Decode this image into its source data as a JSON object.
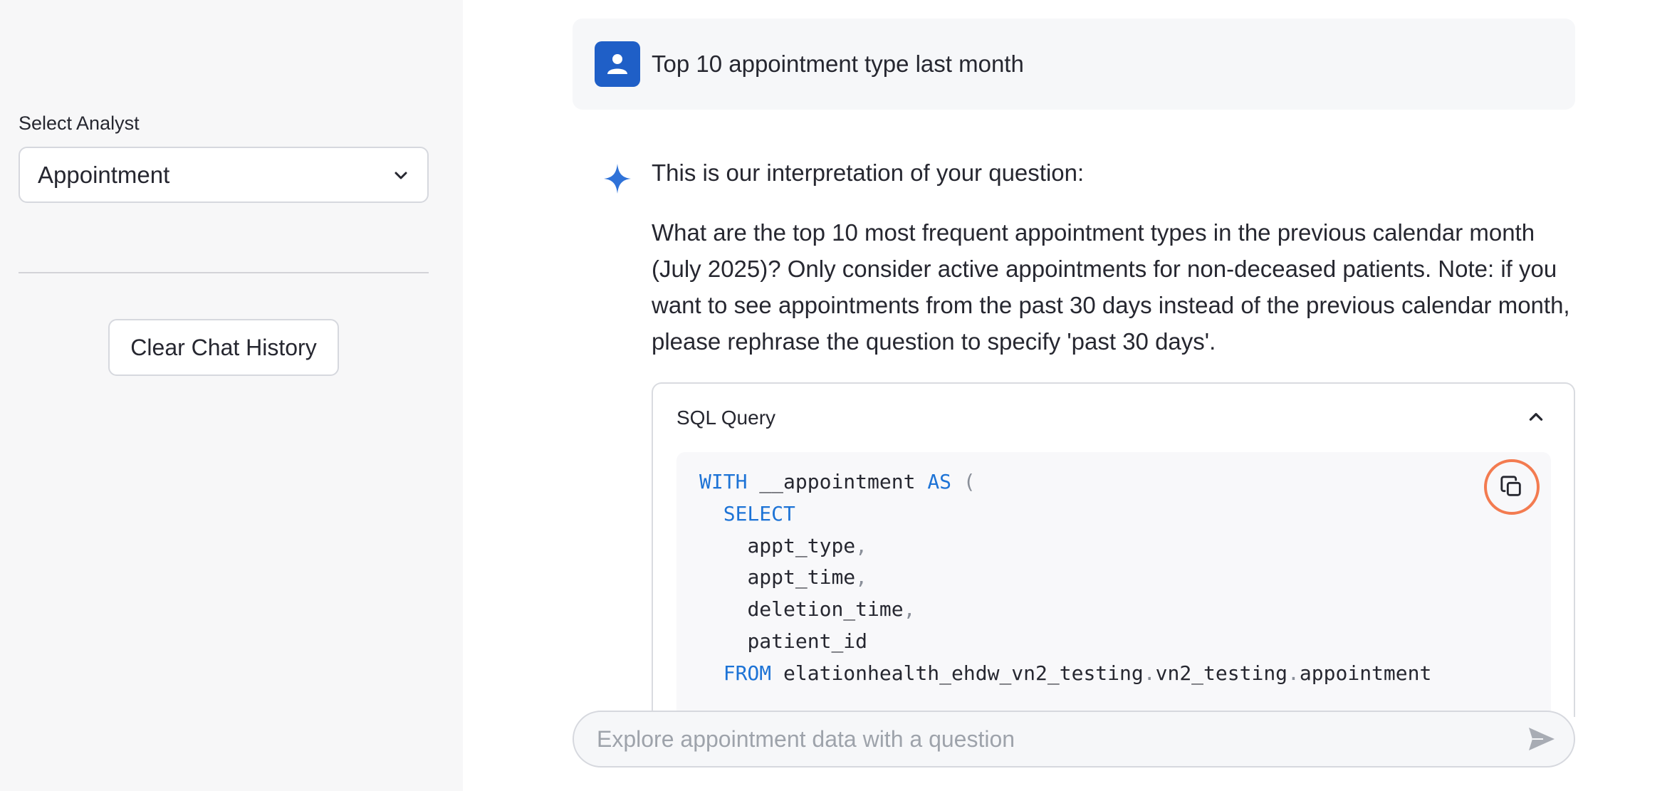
{
  "sidebar": {
    "analyst_label": "Select Analyst",
    "analyst_value": "Appointment",
    "clear_button": "Clear Chat History"
  },
  "user_message": {
    "text": "Top 10 appointment type last month"
  },
  "assistant_message": {
    "intro": "This is our interpretation of your question:",
    "interpretation": "What are the top 10 most frequent appointment types in the previous calendar month (July 2025)? Only consider active appointments for non-deceased patients. Note: if you want to see appointments from the past 30 days instead of the previous calendar month, please rephrase the question to specify 'past 30 days'.",
    "sql": {
      "title": "SQL Query",
      "lines": [
        {
          "indent": "",
          "tokens": [
            {
              "t": "kw",
              "v": "WITH"
            },
            {
              "t": "tx",
              "v": " __appointment "
            },
            {
              "t": "kw",
              "v": "AS"
            },
            {
              "t": "tx",
              "v": " "
            },
            {
              "t": "pn",
              "v": "("
            }
          ]
        },
        {
          "indent": "  ",
          "tokens": [
            {
              "t": "kw",
              "v": "SELECT"
            }
          ]
        },
        {
          "indent": "    ",
          "tokens": [
            {
              "t": "tx",
              "v": "appt_type"
            },
            {
              "t": "pn",
              "v": ","
            }
          ]
        },
        {
          "indent": "    ",
          "tokens": [
            {
              "t": "tx",
              "v": "appt_time"
            },
            {
              "t": "pn",
              "v": ","
            }
          ]
        },
        {
          "indent": "    ",
          "tokens": [
            {
              "t": "tx",
              "v": "deletion_time"
            },
            {
              "t": "pn",
              "v": ","
            }
          ]
        },
        {
          "indent": "    ",
          "tokens": [
            {
              "t": "tx",
              "v": "patient_id"
            }
          ]
        },
        {
          "indent": "  ",
          "tokens": [
            {
              "t": "kw",
              "v": "FROM"
            },
            {
              "t": "tx",
              "v": " elationhealth_ehdw_vn2_testing"
            },
            {
              "t": "pn",
              "v": "."
            },
            {
              "t": "tx",
              "v": "vn2_testing"
            },
            {
              "t": "pn",
              "v": "."
            },
            {
              "t": "tx",
              "v": "appointment"
            }
          ]
        }
      ]
    }
  },
  "chat_input": {
    "placeholder": "Explore appointment data with a question"
  },
  "icons": {
    "avatar": "user-icon",
    "assistant": "sparkle-icon",
    "select": "chevron-down-icon",
    "expander": "chevron-up-icon",
    "copy": "copy-icon",
    "send": "send-icon"
  },
  "colors": {
    "avatar_bg": "#1f5fc7",
    "sparkle": "#2f72d8",
    "keyword": "#1d73d6",
    "copy_highlight": "#f37b50"
  }
}
